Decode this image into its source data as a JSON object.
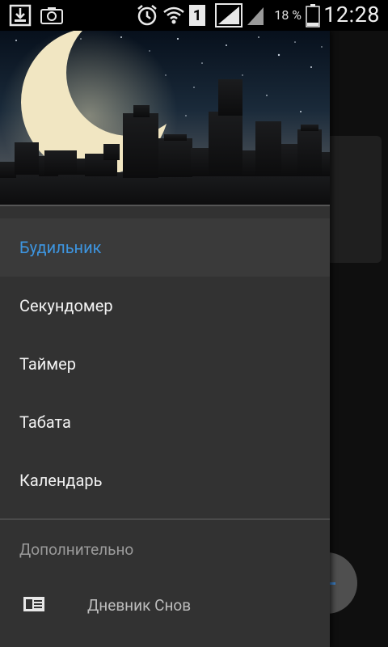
{
  "status_bar": {
    "time": "12:28",
    "battery_percent": "18 %",
    "sim_badge": "1",
    "icons": [
      "download-icon",
      "camera-icon",
      "alarm-icon",
      "wifi-icon",
      "sim-badge",
      "signal-icon",
      "signal-icon-2",
      "battery-icon"
    ]
  },
  "drawer": {
    "menu": [
      {
        "label": "Будильник",
        "selected": true
      },
      {
        "label": "Секундомер",
        "selected": false
      },
      {
        "label": "Таймер",
        "selected": false
      },
      {
        "label": "Табата",
        "selected": false
      },
      {
        "label": "Календарь",
        "selected": false
      }
    ],
    "section_header": "Дополнительно",
    "extra_items": [
      {
        "label": "Дневник Снов",
        "icon": "journal-icon"
      }
    ]
  },
  "colors": {
    "accent": "#3d95e0",
    "drawer_bg": "#323232",
    "selected_bg": "#3a3a3a"
  }
}
